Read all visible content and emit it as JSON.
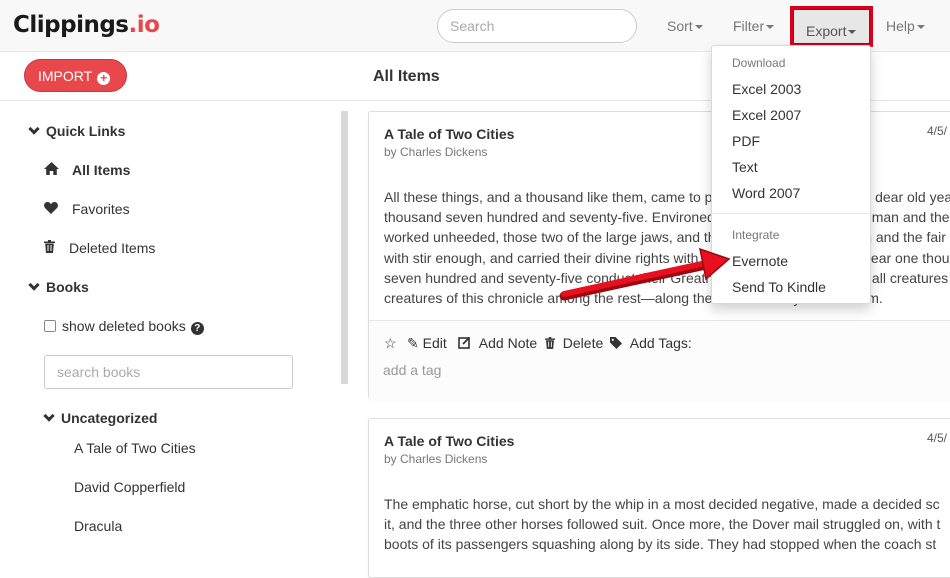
{
  "app": {
    "logo_main": "Clippings",
    "logo_tld": ".io"
  },
  "navbar": {
    "search_placeholder": "Search",
    "sort_label": "Sort",
    "filter_label": "Filter",
    "export_label": "Export",
    "help_label": "Help"
  },
  "toolbar": {
    "import_label": "IMPORT",
    "import_icon": "+"
  },
  "main": {
    "title": "All Items"
  },
  "sidebar": {
    "quick_links_label": "Quick Links",
    "all_items_label": "All Items",
    "favorites_label": "Favorites",
    "deleted_items_label": "Deleted Items",
    "books_label": "Books",
    "show_deleted_label": "show deleted books",
    "help_icon": "?",
    "book_search_placeholder": "search books",
    "uncategorized_label": "Uncategorized",
    "books": [
      "A Tale of Two Cities",
      "David Copperfield",
      "Dracula"
    ]
  },
  "cards": [
    {
      "title": "A Tale of Two Cities",
      "author": "by Charles Dickens",
      "date": "4/5/",
      "lines": [
        "All these things, and a thousand like them, came to pass in and close upon the dear old year one",
        "thousand seven hundred and seventy-five. Environed by them, while the Woodman and the",
        "worked unheeded, those two of the large jaws, and those other two of the plain and the fair",
        "with stir enough, and carried their divine rights with a high hand. Thus did the year one thou",
        "seven hundred and seventy-five conduct their Greatnesses, and myriads of small creatures",
        "creatures of this chronicle among the rest—along the roads that lay before them."
      ],
      "actions": {
        "edit": "Edit",
        "add_note": "Add Note",
        "delete": "Delete",
        "add_tags": "Add Tags:"
      },
      "tag_placeholder": "add a tag"
    },
    {
      "title": "A Tale of Two Cities",
      "author": "by Charles Dickens",
      "date": "4/5/",
      "lines": [
        "The emphatic horse, cut short by the whip in a most decided negative, made a decided sc",
        "it, and the three other horses followed suit. Once more, the Dover mail struggled on, with t",
        "boots of its passengers squashing along by its side. They had stopped when the coach st"
      ]
    }
  ],
  "export_menu": {
    "download_header": "Download",
    "download_items": [
      "Excel 2003",
      "Excel 2007",
      "PDF",
      "Text",
      "Word 2007"
    ],
    "integrate_header": "Integrate",
    "integrate_items": [
      "Evernote",
      "Send To Kindle"
    ]
  },
  "colors": {
    "brand": "#e8474c",
    "highlight": "#d9001b",
    "annotation_arrow": "#e8101e"
  }
}
